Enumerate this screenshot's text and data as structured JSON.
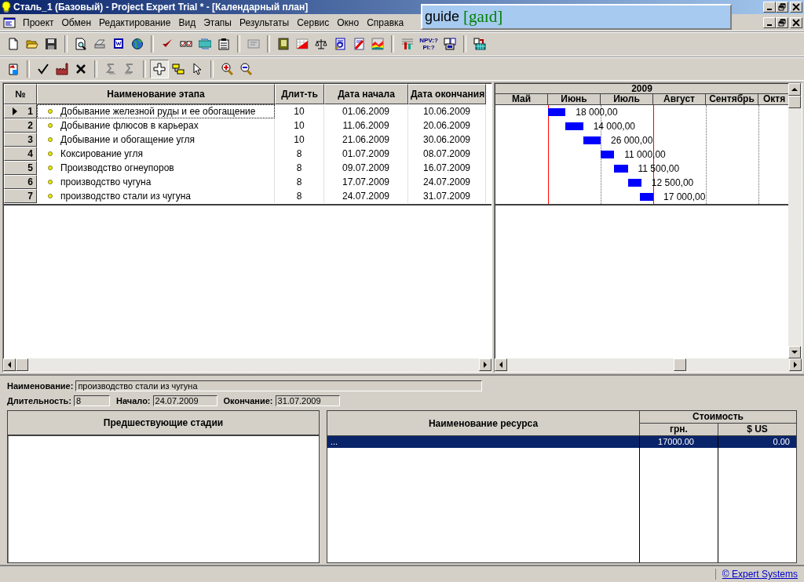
{
  "window": {
    "title": "Сталь_1 (Базовый) - Project Expert Trial * - [Календарный план]"
  },
  "menu": [
    "Проект",
    "Обмен",
    "Редактирование",
    "Вид",
    "Этапы",
    "Результаты",
    "Сервис",
    "Окно",
    "Справка"
  ],
  "toolbar": {
    "indicator_lines": [
      "NPV:?",
      "PI:?"
    ]
  },
  "toolbar_2": {
    "mode_tools": [
      {
        "selected": true
      },
      {
        "selected": false
      },
      {
        "selected": false
      }
    ]
  },
  "stages_table": {
    "columns": [
      "№",
      "Наименование этапа",
      "Длит-ть",
      "Дата начала",
      "Дата окончания"
    ],
    "rows": [
      {
        "number": "1",
        "name": "Добывание железной руды и ее обогащение",
        "duration": "10",
        "start": "01.06.2009",
        "end": "10.06.2009",
        "selected": true
      },
      {
        "number": "2",
        "name": "Добывание флюсов в карьерах",
        "duration": "10",
        "start": "11.06.2009",
        "end": "20.06.2009",
        "selected": false
      },
      {
        "number": "3",
        "name": "Добывание и обогащение угля",
        "duration": "10",
        "start": "21.06.2009",
        "end": "30.06.2009",
        "selected": false
      },
      {
        "number": "4",
        "name": "Коксирование угля",
        "duration": "8",
        "start": "01.07.2009",
        "end": "08.07.2009",
        "selected": false
      },
      {
        "number": "5",
        "name": "Производство огнеупоров",
        "duration": "8",
        "start": "09.07.2009",
        "end": "16.07.2009",
        "selected": false
      },
      {
        "number": "6",
        "name": "производство чугуна",
        "duration": "8",
        "start": "17.07.2009",
        "end": "24.07.2009",
        "selected": false
      },
      {
        "number": "7",
        "name": "производство стали из чугуна",
        "duration": "8",
        "start": "24.07.2009",
        "end": "31.07.2009",
        "selected": false
      }
    ]
  },
  "gantt": {
    "year": "2009",
    "months": [
      "Май",
      "Июнь",
      "Июль",
      "Август",
      "Сентябрь",
      "Октя"
    ],
    "bar_labels": [
      "18 000,00",
      "14 000,00",
      "26 000,00",
      "11 000,00",
      "11 500,00",
      "12 500,00",
      "17 000,00"
    ]
  },
  "details": {
    "name_label": "Наименование:",
    "name_value": "производство стали из чугуна",
    "duration_label": "Длительность:",
    "duration_value": "8",
    "start_label": "Начало:",
    "start_value": "24.07.2009",
    "end_label": "Окончание:",
    "end_value": "31.07.2009"
  },
  "predecessors": {
    "column": "Предшествующие стадии"
  },
  "resources": {
    "name_column": "Наименование ресурса",
    "cost_group": "Стоимость",
    "cost_columns": [
      "грн.",
      "$ US"
    ],
    "rows": [
      {
        "name": "...",
        "uah": "17000.00",
        "usd": "0.00",
        "selected": true
      }
    ]
  },
  "status_bar": {
    "link": "© Expert Systems"
  },
  "dictionary_popup": {
    "word": "guide",
    "transcription": "[gaɪd]"
  }
}
